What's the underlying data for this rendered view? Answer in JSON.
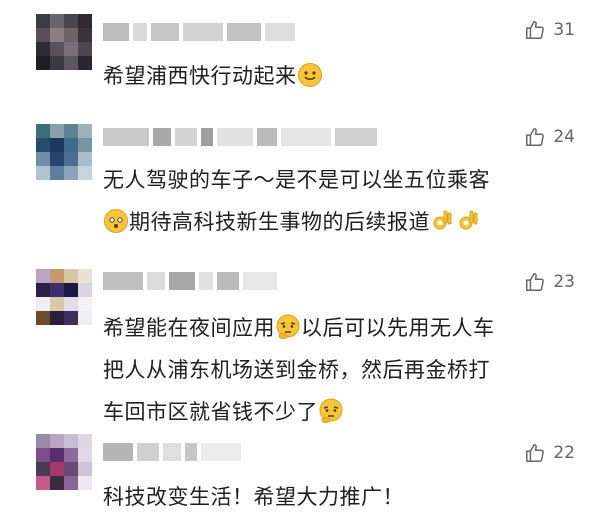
{
  "comments": [
    {
      "likes": "31",
      "lines": [
        "希望浦西快行动起来"
      ],
      "emojis": [
        "smile-emoji"
      ]
    },
    {
      "likes": "24",
      "line1": "无人驾驶的车子～是不是可以坐五位乘客",
      "line2": "期待高科技新生事物的后续报道",
      "emojis": [
        "curious-emoji",
        "ok-hand-emoji",
        "ok-hand-emoji"
      ]
    },
    {
      "likes": "23",
      "line1": "希望能在夜间应用",
      "line1b": "以后可以先用无人车",
      "line2": "把人从浦东机场送到金桥，然后再金桥打",
      "line3": "车回市区就省钱不少了",
      "emojis": [
        "thinking-emoji",
        "thinking-emoji"
      ]
    },
    {
      "likes": "22",
      "line1": "科技改变生活！希望大力推广！"
    }
  ],
  "colors": {
    "like_icon": "#666666",
    "text": "#1f1f1f",
    "blur": "#cfcfcf"
  }
}
